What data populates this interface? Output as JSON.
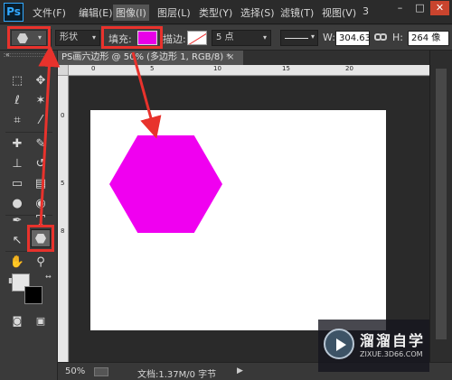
{
  "app": {
    "logo_text": "Ps"
  },
  "menubar": {
    "items": [
      {
        "label": "文件(F)"
      },
      {
        "label": "编辑(E)"
      },
      {
        "label": "图像(I)"
      },
      {
        "label": "图层(L)"
      },
      {
        "label": "类型(Y)"
      },
      {
        "label": "选择(S)"
      },
      {
        "label": "滤镜(T)"
      },
      {
        "label": "视图(V)"
      },
      {
        "label": "3"
      }
    ],
    "active_item": "图像(I)",
    "window_controls": {
      "minimize": "–",
      "maximize": "□",
      "close": "✕"
    }
  },
  "options_bar": {
    "tool_mode": "形状",
    "fill_label": "填充:",
    "fill_color": "#e800e8",
    "stroke_label": "描边:",
    "stroke_width": "5 点",
    "width_label": "W:",
    "width_value": "304.63",
    "height_label": "H:",
    "height_value": "264 像",
    "caret": "▾"
  },
  "document": {
    "tab_title": "PS画六边形 @ 50% (多边形 1, RGB/8) *",
    "tab_close": "×",
    "shape_color": "#f000f0",
    "canvas_color": "#ffffff"
  },
  "rulers": {
    "top_ticks": [
      "0",
      "5",
      "10",
      "15",
      "20"
    ],
    "left_ticks": [
      "0",
      "5",
      "8"
    ]
  },
  "toolbox": {
    "tools": [
      {
        "name": "marquee-tool",
        "glyph": "⬚"
      },
      {
        "name": "move-tool",
        "glyph": "✥"
      },
      {
        "name": "lasso-tool",
        "glyph": "ℓ"
      },
      {
        "name": "magic-wand-tool",
        "glyph": "✶"
      },
      {
        "name": "crop-tool",
        "glyph": "⌗"
      },
      {
        "name": "eyedropper-tool",
        "glyph": "⁄"
      },
      {
        "name": "healing-brush-tool",
        "glyph": "✚"
      },
      {
        "name": "brush-tool",
        "glyph": "✎"
      },
      {
        "name": "clone-stamp-tool",
        "glyph": "⊥"
      },
      {
        "name": "history-brush-tool",
        "glyph": "↺"
      },
      {
        "name": "eraser-tool",
        "glyph": "▭"
      },
      {
        "name": "gradient-tool",
        "glyph": "▤"
      },
      {
        "name": "blur-tool",
        "glyph": "●"
      },
      {
        "name": "dodge-tool",
        "glyph": "◉"
      },
      {
        "name": "pen-tool",
        "glyph": "✒"
      },
      {
        "name": "type-tool",
        "glyph": "T"
      },
      {
        "name": "path-selection-tool",
        "glyph": "↖"
      },
      {
        "name": "polygon-tool",
        "glyph": ""
      },
      {
        "name": "hand-tool",
        "glyph": "✋"
      },
      {
        "name": "zoom-tool",
        "glyph": "⚲"
      }
    ]
  },
  "status_bar": {
    "zoom": "50%",
    "doc_info": "文档:1.37M/0 字节",
    "arrow": "▶"
  },
  "watermark": {
    "title": "溜溜自学",
    "subtitle": "ZIXUE.3D66.COM"
  },
  "annotation_color": "#e8322c"
}
